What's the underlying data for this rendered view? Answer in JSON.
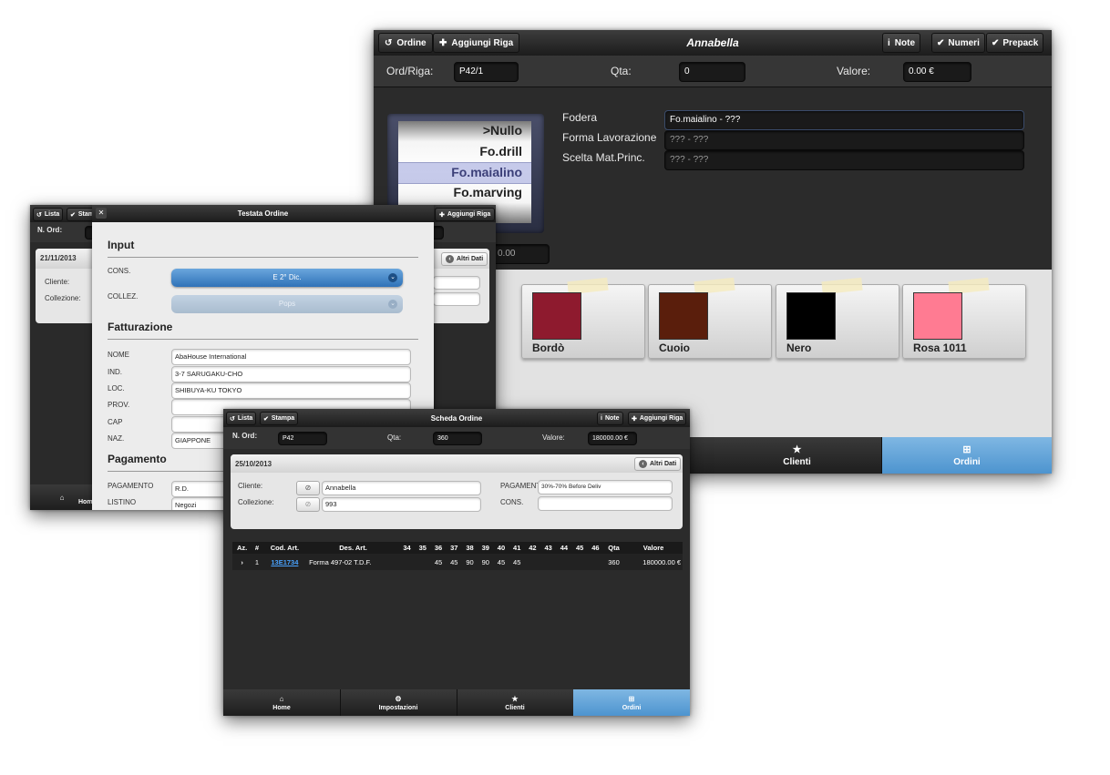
{
  "screen_a": {
    "toolbar": {
      "btn_ordine": "Ordine",
      "btn_aggiungi": "Aggiungi Riga",
      "title": "Annabella",
      "btn_note": "Note",
      "btn_numeri": "Numeri",
      "btn_prepack": "Prepack"
    },
    "info": {
      "ord_label": "Ord/Riga:",
      "ord_value": "P42/1",
      "qta_label": "Qta:",
      "qta_value": "0",
      "valore_label": "Valore:",
      "valore_value": "0.00 €"
    },
    "picker": [
      ">Nullo",
      "Fo.drill",
      "Fo.maialino",
      "Fo.marving"
    ],
    "fields": [
      {
        "label": "Fodera",
        "value": "Fo.maialino - ???"
      },
      {
        "label": "Forma Lavorazione",
        "value": "??? - ???"
      },
      {
        "label": "Scelta Mat.Princ.",
        "value": "??? - ???"
      }
    ],
    "price_value": "0.00",
    "swatches": [
      {
        "name": "Bordò",
        "color": "#8e1a2e"
      },
      {
        "name": "Cuoio",
        "color": "#5a1e0c"
      },
      {
        "name": "Nero",
        "color": "#000000"
      },
      {
        "name": "Rosa 1011",
        "color": "#ff7b92"
      }
    ],
    "tabs": {
      "clienti": "Clienti",
      "ordini": "Ordini"
    }
  },
  "screen_b": {
    "toolbar": {
      "btn_lista": "Lista",
      "btn_stampa": "Stam",
      "btn_aggiungi": "Aggiungi Riga"
    },
    "nord_label": "N. Ord:",
    "date": "21/11/2013",
    "cliente_label": "Cliente:",
    "collezione_label": "Collezione:",
    "altri_dati": "Altri Dati",
    "tab_home": "Hom",
    "dialog": {
      "title": "Testata Ordine",
      "section_input": "Input",
      "cons_label": "CONS.",
      "cons_value": "E 2° Dic.",
      "collez_label": "COLLEZ.",
      "collez_value": "Pops",
      "section_fatt": "Fatturazione",
      "nome_label": "NOME",
      "nome_value": "AbaHouse International",
      "ind_label": "IND.",
      "ind_value": "3-7 SARUGAKU-CHO",
      "loc_label": "LOC.",
      "loc_value": "SHIBUYA-KU  TOKYO",
      "prov_label": "PROV.",
      "prov_value": "",
      "cap_label": "CAP",
      "cap_value": "",
      "naz_label": "NAZ.",
      "naz_value": "GIAPPONE",
      "section_pag": "Pagamento",
      "pagamento_label": "PAGAMENTO",
      "pagamento_value": "R.D.",
      "listino_label": "LISTINO",
      "listino_value": "Negozi"
    }
  },
  "screen_c": {
    "toolbar": {
      "btn_lista": "Lista",
      "btn_stampa": "Stampa",
      "title": "Scheda Ordine",
      "btn_note": "Note",
      "btn_aggiungi": "Aggiungi Riga"
    },
    "info": {
      "nord_label": "N. Ord:",
      "nord_value": "P42",
      "qta_label": "Qta:",
      "qta_value": "360",
      "valore_label": "Valore:",
      "valore_value": "180000.00 €"
    },
    "date": "25/10/2013",
    "altri_dati": "Altri Dati",
    "cliente_label": "Cliente:",
    "cliente_value": "Annabella",
    "collezione_label": "Collezione:",
    "collezione_value": "993",
    "pagamento_label": "PAGAMENT",
    "pagamento_value": "30%-70% Before Deliv",
    "cons_label": "CONS.",
    "cons_value": "",
    "table": {
      "headers": [
        "Az.",
        "#",
        "Cod. Art.",
        "Des. Art.",
        "34",
        "35",
        "36",
        "37",
        "38",
        "39",
        "40",
        "41",
        "42",
        "43",
        "44",
        "45",
        "46",
        "Qta",
        "Valore"
      ],
      "rows": [
        [
          "›",
          "1",
          "13E1734",
          "Forma 497-02 T.D.F.",
          "",
          "",
          "45",
          "45",
          "90",
          "90",
          "45",
          "45",
          "",
          "",
          "",
          "",
          "",
          "360",
          "180000.00 €"
        ]
      ]
    },
    "tabs": {
      "home": "Home",
      "impostazioni": "Impostazioni",
      "clienti": "Clienti",
      "ordini": "Ordini"
    }
  }
}
